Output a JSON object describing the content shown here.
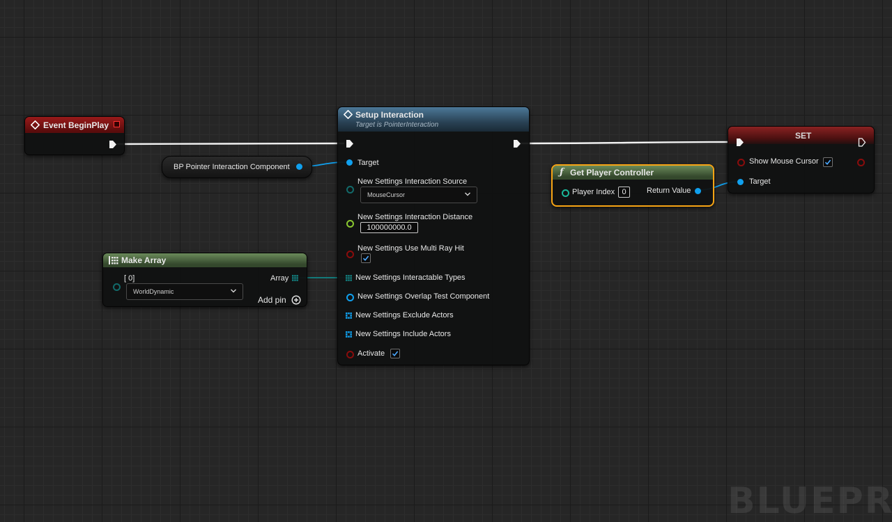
{
  "colors": {
    "event_header": "#8a1414",
    "function_header": "#3d6b8a",
    "pure_header": "#5f7a50",
    "set_header": "#6a1e1e",
    "object_pin": "#10a0ee",
    "float_pin": "#8ac830",
    "bool_pin": "#8a0c0c",
    "byte_pin": "#126a6a",
    "struct_pin": "#137a9a",
    "selection": "#f7a414"
  },
  "nodes": {
    "event_begin_play": {
      "title": "Event BeginPlay",
      "icon": "event-diamond-icon"
    },
    "pointer_component": {
      "label": "BP Pointer Interaction Component"
    },
    "setup_interaction": {
      "title": "Setup Interaction",
      "subtitle": "Target is PointerInteraction",
      "icon": "function-diamond-icon",
      "pins": {
        "target": "Target",
        "interaction_source": "New Settings Interaction Source",
        "interaction_source_value": "MouseCursor",
        "interaction_distance": "New Settings Interaction Distance",
        "interaction_distance_value": "100000000.0",
        "use_multi_ray_hit": "New Settings Use Multi Ray Hit",
        "use_multi_ray_hit_checked": true,
        "interactable_types": "New Settings Interactable Types",
        "overlap_test_component": "New Settings Overlap Test Component",
        "exclude_actors": "New Settings Exclude Actors",
        "include_actors": "New Settings Include Actors",
        "activate": "Activate",
        "activate_checked": true
      }
    },
    "make_array": {
      "title": "Make Array",
      "icon": "array-grid-icon",
      "index_label": "[ 0]",
      "item_value": "WorldDynamic",
      "output_label": "Array",
      "add_pin_label": "Add pin",
      "add_pin_icon": "plus-circle-icon"
    },
    "get_player_controller": {
      "title": "Get Player Controller",
      "icon": "function-f-icon",
      "input_label": "Player Index",
      "input_value": "0",
      "output_label": "Return Value",
      "selected": true
    },
    "set_node": {
      "title": "SET",
      "variable_label": "Show Mouse Cursor",
      "variable_checked": true,
      "target_label": "Target"
    }
  },
  "watermark": "BLUEPRINT"
}
